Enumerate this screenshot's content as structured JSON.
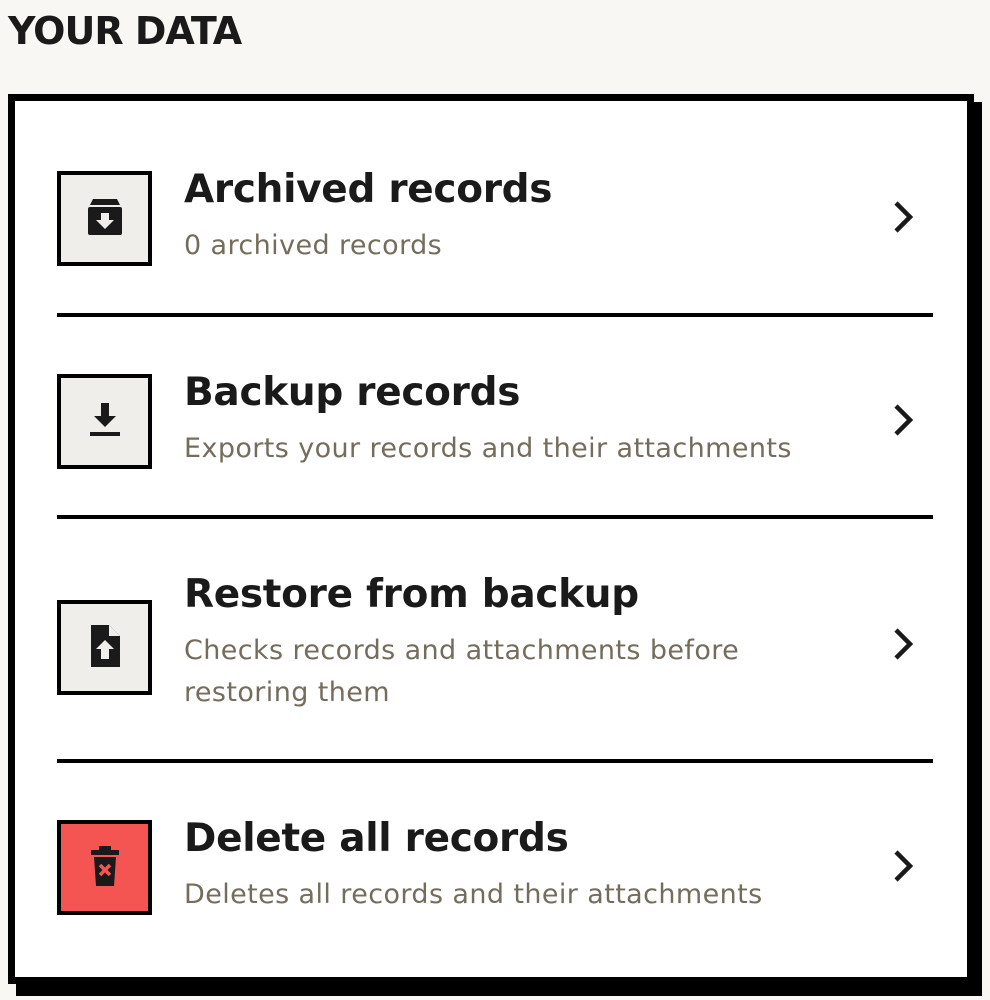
{
  "section": {
    "title": "YOUR DATA"
  },
  "rows": [
    {
      "title": "Archived records",
      "subtitle": "0 archived records",
      "icon": "archive-box-icon",
      "danger": false
    },
    {
      "title": "Backup records",
      "subtitle": "Exports your records and their attachments",
      "icon": "download-icon",
      "danger": false
    },
    {
      "title": "Restore from backup",
      "subtitle": "Checks records and attachments before restoring them",
      "icon": "file-upload-icon",
      "danger": false
    },
    {
      "title": "Delete all records",
      "subtitle": "Deletes all records and their attachments",
      "icon": "trash-icon",
      "danger": true
    }
  ],
  "colors": {
    "background": "#f8f7f3",
    "card": "#ffffff",
    "icon_box": "#efeeea",
    "danger": "#f45452",
    "subtitle": "#746d5e",
    "text": "#1a1a1a"
  },
  "chevron_icon": "chevron-right-icon"
}
